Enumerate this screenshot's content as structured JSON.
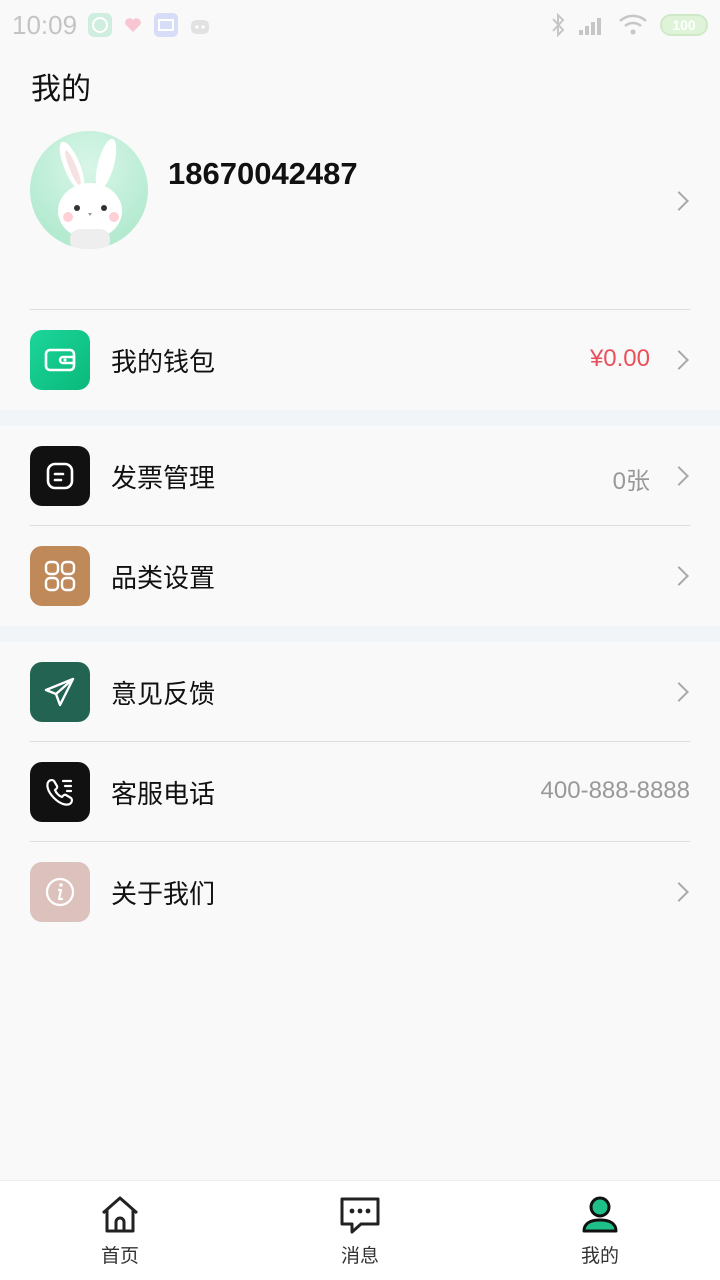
{
  "status": {
    "time": "10:09",
    "battery": "100"
  },
  "page": {
    "title": "我的"
  },
  "profile": {
    "phone": "18670042487"
  },
  "menu": {
    "wallet": {
      "label": "我的钱包",
      "value": "¥0.00"
    },
    "invoice": {
      "label": "发票管理",
      "value": "0张"
    },
    "category": {
      "label": "品类设置"
    },
    "feedback": {
      "label": "意见反馈"
    },
    "service": {
      "label": "客服电话",
      "value": "400-888-8888"
    },
    "about": {
      "label": "关于我们"
    }
  },
  "tabbar": {
    "items": [
      {
        "label": "首页",
        "icon": "home-icon"
      },
      {
        "label": "消息",
        "icon": "message-icon"
      },
      {
        "label": "我的",
        "icon": "user-icon"
      }
    ]
  },
  "colors": {
    "accent": "#1fbf8a",
    "money": "#e8505b",
    "wallet_icon": "#12c98a",
    "invoice_icon": "#111111",
    "category_icon": "#c0895a",
    "feedback_icon": "#226352",
    "service_icon": "#111111",
    "about_icon": "#dcc1bc"
  }
}
